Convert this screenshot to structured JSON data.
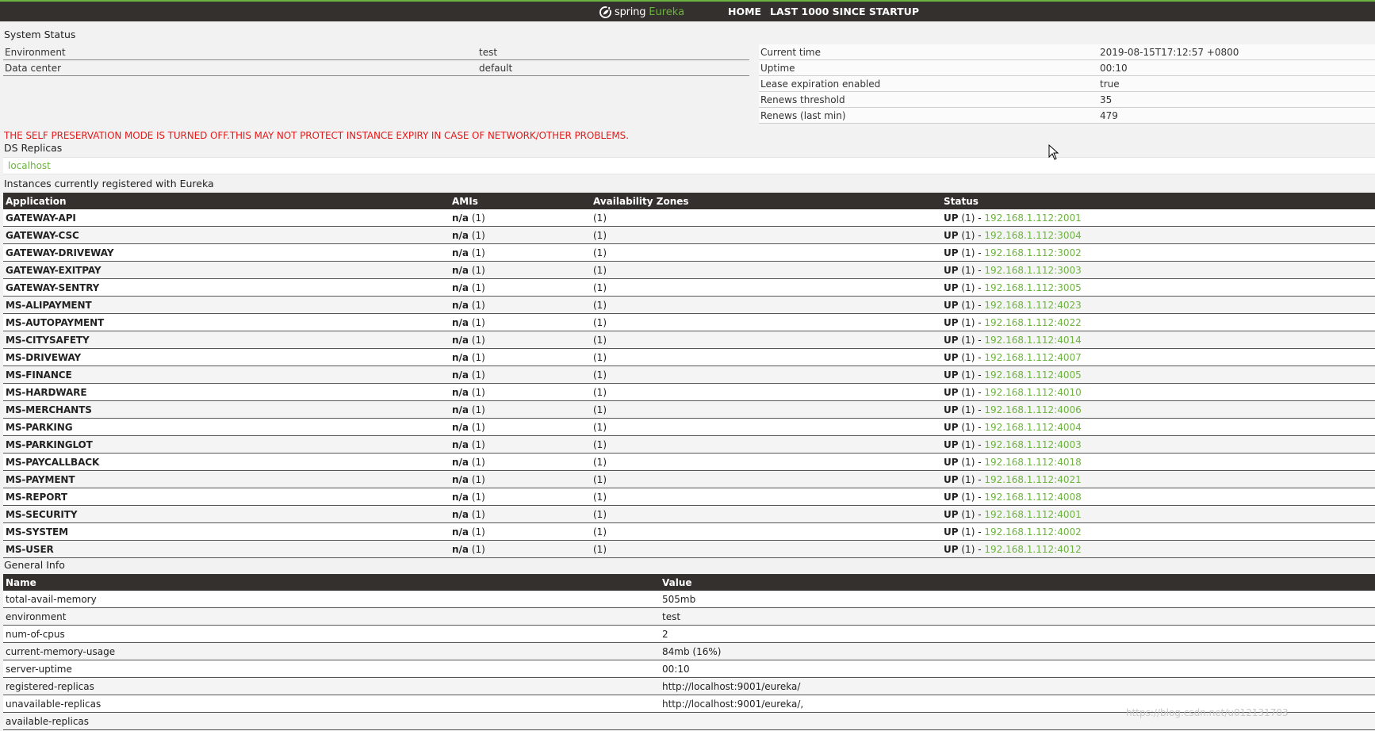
{
  "colors": {
    "brand_green": "#6db33f",
    "navbar": "#34302d",
    "warning_red": "#e61a1a"
  },
  "navbar": {
    "brand_spring": "spring",
    "brand_eureka": "Eureka",
    "logo_icon": "spring-leaf-icon",
    "home": "HOME",
    "last1000": "LAST 1000 SINCE STARTUP"
  },
  "system_status": {
    "title": "System Status",
    "left": [
      {
        "label": "Environment",
        "value": "test"
      },
      {
        "label": "Data center",
        "value": "default"
      }
    ],
    "right": [
      {
        "label": "Current time",
        "value": "2019-08-15T17:12:57 +0800"
      },
      {
        "label": "Uptime",
        "value": "00:10"
      },
      {
        "label": "Lease expiration enabled",
        "value": "true"
      },
      {
        "label": "Renews threshold",
        "value": "35"
      },
      {
        "label": "Renews (last min)",
        "value": "479"
      }
    ]
  },
  "warning": "THE SELF PRESERVATION MODE IS TURNED OFF.THIS MAY NOT PROTECT INSTANCE EXPIRY IN CASE OF NETWORK/OTHER PROBLEMS.",
  "replicas": {
    "title": "DS Replicas",
    "items": [
      "localhost"
    ]
  },
  "instances": {
    "title": "Instances currently registered with Eureka",
    "headers": [
      "Application",
      "AMIs",
      "Availability Zones",
      "Status"
    ],
    "rows": [
      {
        "app": "GATEWAY-API",
        "ami": "n/a",
        "ami_count": "(1)",
        "zones": "(1)",
        "status": "UP",
        "status_count": "(1) -",
        "instance": "192.168.1.112:2001"
      },
      {
        "app": "GATEWAY-CSC",
        "ami": "n/a",
        "ami_count": "(1)",
        "zones": "(1)",
        "status": "UP",
        "status_count": "(1) -",
        "instance": "192.168.1.112:3004"
      },
      {
        "app": "GATEWAY-DRIVEWAY",
        "ami": "n/a",
        "ami_count": "(1)",
        "zones": "(1)",
        "status": "UP",
        "status_count": "(1) -",
        "instance": "192.168.1.112:3002"
      },
      {
        "app": "GATEWAY-EXITPAY",
        "ami": "n/a",
        "ami_count": "(1)",
        "zones": "(1)",
        "status": "UP",
        "status_count": "(1) -",
        "instance": "192.168.1.112:3003"
      },
      {
        "app": "GATEWAY-SENTRY",
        "ami": "n/a",
        "ami_count": "(1)",
        "zones": "(1)",
        "status": "UP",
        "status_count": "(1) -",
        "instance": "192.168.1.112:3005"
      },
      {
        "app": "MS-ALIPAYMENT",
        "ami": "n/a",
        "ami_count": "(1)",
        "zones": "(1)",
        "status": "UP",
        "status_count": "(1) -",
        "instance": "192.168.1.112:4023"
      },
      {
        "app": "MS-AUTOPAYMENT",
        "ami": "n/a",
        "ami_count": "(1)",
        "zones": "(1)",
        "status": "UP",
        "status_count": "(1) -",
        "instance": "192.168.1.112:4022"
      },
      {
        "app": "MS-CITYSAFETY",
        "ami": "n/a",
        "ami_count": "(1)",
        "zones": "(1)",
        "status": "UP",
        "status_count": "(1) -",
        "instance": "192.168.1.112:4014"
      },
      {
        "app": "MS-DRIVEWAY",
        "ami": "n/a",
        "ami_count": "(1)",
        "zones": "(1)",
        "status": "UP",
        "status_count": "(1) -",
        "instance": "192.168.1.112:4007"
      },
      {
        "app": "MS-FINANCE",
        "ami": "n/a",
        "ami_count": "(1)",
        "zones": "(1)",
        "status": "UP",
        "status_count": "(1) -",
        "instance": "192.168.1.112:4005"
      },
      {
        "app": "MS-HARDWARE",
        "ami": "n/a",
        "ami_count": "(1)",
        "zones": "(1)",
        "status": "UP",
        "status_count": "(1) -",
        "instance": "192.168.1.112:4010"
      },
      {
        "app": "MS-MERCHANTS",
        "ami": "n/a",
        "ami_count": "(1)",
        "zones": "(1)",
        "status": "UP",
        "status_count": "(1) -",
        "instance": "192.168.1.112:4006"
      },
      {
        "app": "MS-PARKING",
        "ami": "n/a",
        "ami_count": "(1)",
        "zones": "(1)",
        "status": "UP",
        "status_count": "(1) -",
        "instance": "192.168.1.112:4004"
      },
      {
        "app": "MS-PARKINGLOT",
        "ami": "n/a",
        "ami_count": "(1)",
        "zones": "(1)",
        "status": "UP",
        "status_count": "(1) -",
        "instance": "192.168.1.112:4003"
      },
      {
        "app": "MS-PAYCALLBACK",
        "ami": "n/a",
        "ami_count": "(1)",
        "zones": "(1)",
        "status": "UP",
        "status_count": "(1) -",
        "instance": "192.168.1.112:4018"
      },
      {
        "app": "MS-PAYMENT",
        "ami": "n/a",
        "ami_count": "(1)",
        "zones": "(1)",
        "status": "UP",
        "status_count": "(1) -",
        "instance": "192.168.1.112:4021"
      },
      {
        "app": "MS-REPORT",
        "ami": "n/a",
        "ami_count": "(1)",
        "zones": "(1)",
        "status": "UP",
        "status_count": "(1) -",
        "instance": "192.168.1.112:4008"
      },
      {
        "app": "MS-SECURITY",
        "ami": "n/a",
        "ami_count": "(1)",
        "zones": "(1)",
        "status": "UP",
        "status_count": "(1) -",
        "instance": "192.168.1.112:4001"
      },
      {
        "app": "MS-SYSTEM",
        "ami": "n/a",
        "ami_count": "(1)",
        "zones": "(1)",
        "status": "UP",
        "status_count": "(1) -",
        "instance": "192.168.1.112:4002"
      },
      {
        "app": "MS-USER",
        "ami": "n/a",
        "ami_count": "(1)",
        "zones": "(1)",
        "status": "UP",
        "status_count": "(1) -",
        "instance": "192.168.1.112:4012"
      }
    ]
  },
  "general_info": {
    "title": "General Info",
    "headers": [
      "Name",
      "Value"
    ],
    "rows": [
      {
        "name": "total-avail-memory",
        "value": "505mb"
      },
      {
        "name": "environment",
        "value": "test"
      },
      {
        "name": "num-of-cpus",
        "value": "2"
      },
      {
        "name": "current-memory-usage",
        "value": "84mb (16%)"
      },
      {
        "name": "server-uptime",
        "value": "00:10"
      },
      {
        "name": "registered-replicas",
        "value": "http://localhost:9001/eureka/"
      },
      {
        "name": "unavailable-replicas",
        "value": "http://localhost:9001/eureka/,"
      },
      {
        "name": "available-replicas",
        "value": ""
      }
    ]
  },
  "watermark": "https://blog.csdn.net/u012131703",
  "cursor_icon": "mouse-pointer-icon"
}
